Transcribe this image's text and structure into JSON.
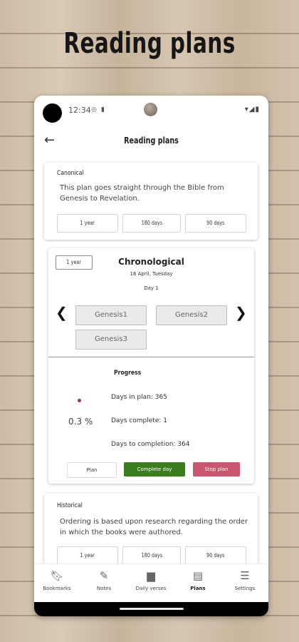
{
  "banner": {
    "title": "Reading plans"
  },
  "status_bar": {
    "time": "12:34",
    "icons": [
      "sync-icon",
      "sd-card-icon"
    ],
    "right_icons": [
      "wifi-icon",
      "signal-icon",
      "battery-icon"
    ]
  },
  "app_bar": {
    "title": "Reading plans",
    "back_icon": "arrow-back-icon"
  },
  "plans": {
    "canonical": {
      "label": "Canonical",
      "description": "This plan goes straight through the Bible from Genesis to Revelation.",
      "durations": [
        "1 year",
        "180 days",
        "90 days"
      ]
    },
    "chronological": {
      "duration_chip": "1 year",
      "title": "Chronological",
      "date": "18 April, Tuesday",
      "day": "Day 1",
      "chapters": [
        "Genesis1",
        "Genesis2",
        "Genesis3"
      ],
      "progress": {
        "title": "Progress",
        "percent": "0.3 %",
        "days_in_plan": "Days in plan: 365",
        "days_complete": "Days complete: 1",
        "days_to_completion": "Days to completion: 364"
      },
      "actions": {
        "plan": "Plan",
        "complete_day": "Complete day",
        "stop_plan": "Stop plan"
      },
      "colors": {
        "complete": "#3a7d1c",
        "stop": "#c9556e",
        "dot": "#b02e4b"
      }
    },
    "historical": {
      "label": "Historical",
      "description": "Ordering is based upon research regarding the order in which the books were authored.",
      "durations": [
        "1 year",
        "180 days",
        "90 days"
      ]
    }
  },
  "bottom_nav": {
    "items": [
      {
        "label": "Bookmarks",
        "icon": "bookmark-icon"
      },
      {
        "label": "Notes",
        "icon": "pencil-icon"
      },
      {
        "label": "Daily verses",
        "icon": "chat-icon"
      },
      {
        "label": "Plans",
        "icon": "calendar-icon",
        "active": true
      },
      {
        "label": "Settings",
        "icon": "sliders-icon"
      }
    ]
  }
}
